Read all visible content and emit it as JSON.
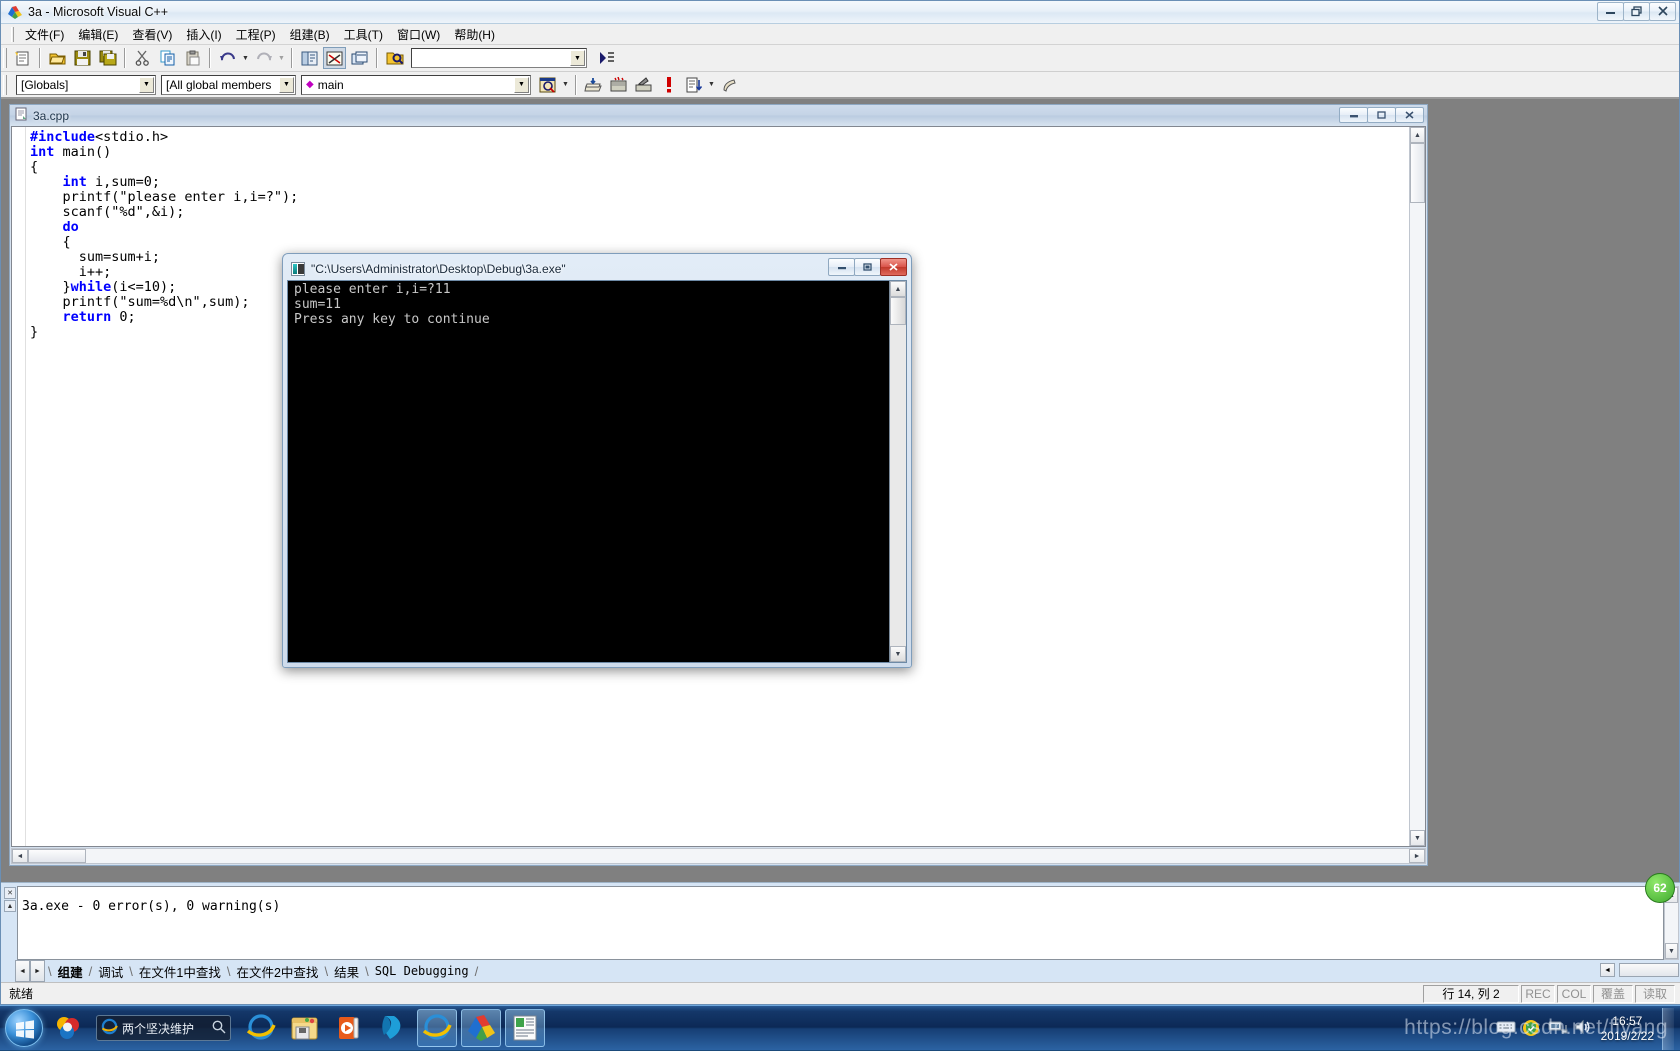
{
  "app": {
    "title": "3a - Microsoft Visual C++",
    "icon": "vcpp-icon",
    "window_buttons": [
      {
        "name": "minimize-button",
        "glyph": "minimize-icon"
      },
      {
        "name": "restore-button",
        "glyph": "restore-icon"
      },
      {
        "name": "close-button",
        "glyph": "close-icon"
      }
    ]
  },
  "menubar": {
    "items": [
      {
        "label": "文件(F)",
        "name": "menu-file"
      },
      {
        "label": "编辑(E)",
        "name": "menu-edit"
      },
      {
        "label": "查看(V)",
        "name": "menu-view"
      },
      {
        "label": "插入(I)",
        "name": "menu-insert"
      },
      {
        "label": "工程(P)",
        "name": "menu-project"
      },
      {
        "label": "组建(B)",
        "name": "menu-build"
      },
      {
        "label": "工具(T)",
        "name": "menu-tools"
      },
      {
        "label": "窗口(W)",
        "name": "menu-window"
      },
      {
        "label": "帮助(H)",
        "name": "menu-help"
      }
    ]
  },
  "toolbar_standard": {
    "buttons": [
      "new-file-icon",
      "open-file-icon",
      "save-icon",
      "save-all-icon",
      "cut-icon",
      "copy-icon",
      "paste-icon",
      "undo-icon",
      "redo-icon",
      "workspace-icon",
      "output-window-icon",
      "window-list-icon",
      "find-in-files-icon"
    ],
    "find_box": {
      "value": "",
      "placeholder": ""
    }
  },
  "toolbar_wizardbar": {
    "scope_combo": {
      "value": "[Globals]",
      "name": "scope-combo"
    },
    "member_combo": {
      "value": "[All global members",
      "name": "member-combo"
    },
    "function_combo": {
      "value": "main",
      "name": "function-combo"
    },
    "buttons": [
      "wizard-icon",
      "compile-icon",
      "build-icon",
      "stop-build-icon",
      "execute-icon",
      "go-debug-icon",
      "insert-breakpoint-icon"
    ]
  },
  "document": {
    "title": "3a.cpp",
    "icon": "cpp-file-icon",
    "window_buttons": [
      {
        "name": "doc-minimize-button",
        "glyph": "minimize-icon"
      },
      {
        "name": "doc-restore-button",
        "glyph": "restore-icon"
      },
      {
        "name": "doc-close-button",
        "glyph": "close-icon"
      }
    ],
    "code_lines": [
      {
        "text": "#include<stdio.h>",
        "tokens": [
          {
            "t": "#include",
            "c": "pp"
          },
          {
            "t": "<stdio.h>",
            "c": ""
          }
        ]
      },
      {
        "text": "int main()",
        "tokens": [
          {
            "t": "int",
            "c": "kw"
          },
          {
            "t": " main()",
            "c": ""
          }
        ]
      },
      {
        "text": "{",
        "tokens": [
          {
            "t": "{",
            "c": ""
          }
        ]
      },
      {
        "text": "    int i,sum=0;",
        "tokens": [
          {
            "t": "    ",
            "c": ""
          },
          {
            "t": "int",
            "c": "kw"
          },
          {
            "t": " i,sum=0;",
            "c": ""
          }
        ]
      },
      {
        "text": "    printf(\"please enter i,i=?\");",
        "tokens": [
          {
            "t": "    printf(\"please enter i,i=?\");",
            "c": ""
          }
        ]
      },
      {
        "text": "    scanf(\"%d\",&i);",
        "tokens": [
          {
            "t": "    scanf(\"%d\",&i);",
            "c": ""
          }
        ]
      },
      {
        "text": "    do",
        "tokens": [
          {
            "t": "    ",
            "c": ""
          },
          {
            "t": "do",
            "c": "kw"
          }
        ]
      },
      {
        "text": "    {",
        "tokens": [
          {
            "t": "    {",
            "c": ""
          }
        ]
      },
      {
        "text": "      sum=sum+i;",
        "tokens": [
          {
            "t": "      sum=sum+i;",
            "c": ""
          }
        ]
      },
      {
        "text": "      i++;",
        "tokens": [
          {
            "t": "      i++;",
            "c": ""
          }
        ]
      },
      {
        "text": "    }while(i<=10);",
        "tokens": [
          {
            "t": "    }",
            "c": ""
          },
          {
            "t": "while",
            "c": "kw"
          },
          {
            "t": "(i<=10);",
            "c": ""
          }
        ]
      },
      {
        "text": "    printf(\"sum=%d\\n\",sum);",
        "tokens": [
          {
            "t": "    printf(\"sum=%d\\n\",sum);",
            "c": ""
          }
        ]
      },
      {
        "text": "    return 0;",
        "tokens": [
          {
            "t": "    ",
            "c": ""
          },
          {
            "t": "return",
            "c": "kw"
          },
          {
            "t": " 0;",
            "c": ""
          }
        ]
      },
      {
        "text": "}",
        "tokens": [
          {
            "t": "}",
            "c": ""
          }
        ]
      }
    ]
  },
  "console": {
    "title": "\"C:\\Users\\Administrator\\Desktop\\Debug\\3a.exe\"",
    "icon": "console-icon",
    "output_lines": [
      "please enter i,i=?11",
      "sum=11",
      "Press any key to continue"
    ],
    "window_buttons": [
      {
        "name": "console-minimize-button",
        "glyph": "minimize-icon"
      },
      {
        "name": "console-maximize-button",
        "glyph": "maximize-icon"
      },
      {
        "name": "console-close-button",
        "glyph": "close-icon"
      }
    ]
  },
  "output_pane": {
    "text": "3a.exe - 0 error(s), 0 warning(s)",
    "tabs": [
      {
        "label": "组建",
        "active": true,
        "name": "output-tab-build"
      },
      {
        "label": "调试",
        "active": false,
        "name": "output-tab-debug"
      },
      {
        "label": "在文件1中查找",
        "active": false,
        "name": "output-tab-find-in-files-1"
      },
      {
        "label": "在文件2中查找",
        "active": false,
        "name": "output-tab-find-in-files-2"
      },
      {
        "label": "结果",
        "active": false,
        "name": "output-tab-results"
      },
      {
        "label": "SQL Debugging",
        "active": false,
        "name": "output-tab-sql-debugging"
      }
    ]
  },
  "statusbar": {
    "message": "就绪",
    "position": "行 14, 列 2",
    "indicators": [
      "REC",
      "COL",
      "覆盖",
      "读取"
    ]
  },
  "taskbar": {
    "start_label": "start-orb",
    "search": {
      "value": "两个坚决维护",
      "placeholder": ""
    },
    "items": [
      {
        "name": "taskbar-icon-security",
        "active": false
      },
      {
        "name": "taskbar-icon-internet-explorer",
        "active": false
      },
      {
        "name": "taskbar-icon-file-explorer",
        "active": false
      },
      {
        "name": "taskbar-icon-media-player",
        "active": false
      },
      {
        "name": "taskbar-icon-kugou",
        "active": false
      },
      {
        "name": "taskbar-icon-ie-window",
        "active": true
      },
      {
        "name": "taskbar-icon-visual-cpp",
        "active": true
      },
      {
        "name": "taskbar-icon-document-window",
        "active": true
      }
    ],
    "tray_icons": [
      "keyboard-icon",
      "shield-icon",
      "network-icon",
      "volume-icon"
    ],
    "clock_time": "16:57",
    "clock_date": "2019/2/22"
  },
  "watermark": {
    "text": "https://blog.csdn.net/fiyang"
  },
  "badge": {
    "text": "62"
  },
  "colors": {
    "keyword": "#0000ff",
    "console_bg": "#000000",
    "console_fg": "#c8c8c8",
    "titlebar_accent": "#dce8f4"
  }
}
